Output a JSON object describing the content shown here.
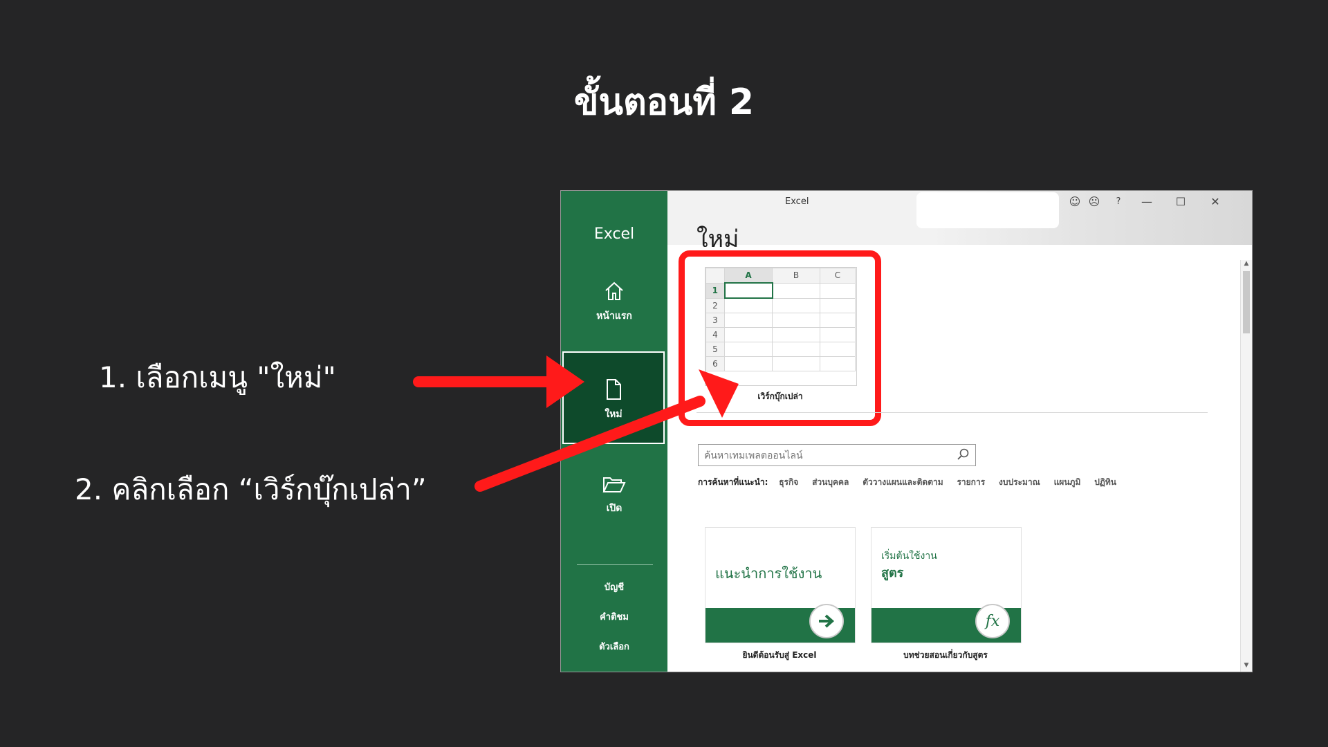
{
  "slide": {
    "title": "ขั้นตอนที่ 2",
    "step1": "1. เลือกเมนู \"ใหม่\"",
    "step2": "2. คลิกเลือก “เวิร์กบุ๊กเปล่า”",
    "arrow_color": "#ff1a1a"
  },
  "excel": {
    "window_title": "Excel",
    "brand": "Excel",
    "accent": "#217346",
    "nav": {
      "home": "หน้าแรก",
      "new": "ใหม่",
      "open": "เปิด",
      "account": "บัญชี",
      "feedback": "คำติชม",
      "options": "ตัวเลือก"
    },
    "controls": {
      "smile": "☺",
      "frown": "☹",
      "help": "?",
      "minimize": "—",
      "maximize": "☐",
      "close": "✕"
    },
    "page_heading": "ใหม่",
    "blank_workbook": {
      "columns": [
        "A",
        "B",
        "C"
      ],
      "rows": [
        "1",
        "2",
        "3",
        "4",
        "5",
        "6"
      ],
      "label": "เวิร์กบุ๊กเปล่า"
    },
    "search": {
      "placeholder": "ค้นหาเทมเพลตออนไลน์"
    },
    "suggested": {
      "lead": "การค้นหาที่แนะนำ:",
      "items": [
        "ธุรกิจ",
        "ส่วนบุคคล",
        "ตัววางแผนและติดตาม",
        "รายการ",
        "งบประมาณ",
        "แผนภูมิ",
        "ปฏิทิน"
      ]
    },
    "templates": [
      {
        "big_text": "แนะนำการใช้งาน",
        "caption": "ยินดีต้อนรับสู่ Excel",
        "icon": "arrow-right-icon"
      },
      {
        "small_text": "เริ่มต้นใช้งาน",
        "big_text": "สูตร",
        "caption": "บทช่วยสอนเกี่ยวกับสูตร",
        "icon": "fx-icon",
        "icon_text": "fx"
      }
    ]
  }
}
